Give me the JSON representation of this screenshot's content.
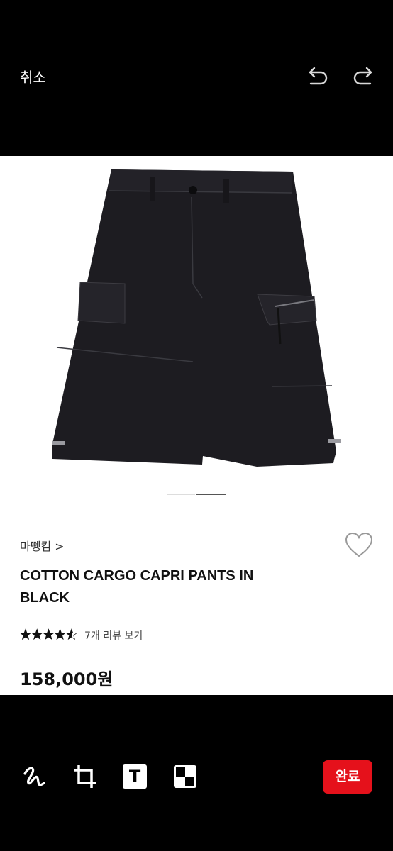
{
  "top_bar": {
    "cancel_label": "취소",
    "undo_icon": "undo-icon",
    "redo_icon": "redo-icon"
  },
  "product": {
    "image_icon": "cargo-shorts-photo",
    "brand_label": "마뗑킴 >",
    "title": "COTTON CARGO CAPRI PANTS IN BLACK",
    "rating_stars": 4.5,
    "rating_max": 5,
    "review_link": "7개 리뷰 보기",
    "price": "158,000원",
    "wishlist_icon": "heart-icon",
    "gallery_pages": 2,
    "gallery_active": 2
  },
  "bottom_bar": {
    "tools": [
      "draw-icon",
      "crop-icon",
      "text-icon",
      "mosaic-icon"
    ],
    "text_tool_glyph": "T",
    "done_label": "완료"
  },
  "colors": {
    "background": "#000000",
    "content": "#ffffff",
    "accent": "#e5111b"
  }
}
